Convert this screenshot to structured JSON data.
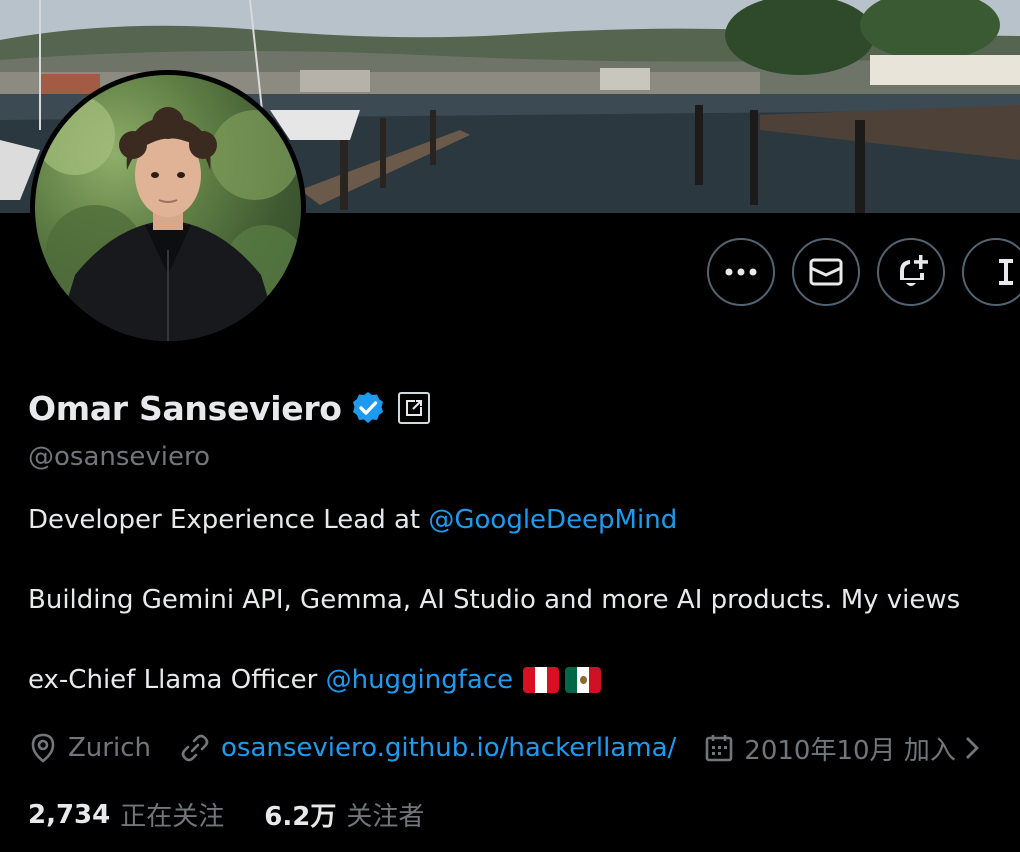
{
  "profile": {
    "display_name": "Omar Sanseviero",
    "handle": "@osanseviero",
    "verified": true,
    "bio": {
      "line1_text": "Developer Experience Lead at ",
      "line1_mention": "@GoogleDeepMind",
      "line2_text": "Building Gemini API, Gemma, AI Studio and more AI products. My views",
      "line3_text": "ex-Chief Llama Officer ",
      "line3_mention": "@huggingface",
      "flags": [
        "peru-flag",
        "mexico-flag"
      ]
    },
    "location": "Zurich",
    "website": "osanseviero.github.io/hackerllama/",
    "joined": "2010年10月 加入"
  },
  "stats": {
    "following_count": "2,734",
    "following_label": "正在关注",
    "followers_count": "6.2万",
    "followers_label": "关注者"
  },
  "actions": [
    {
      "name": "more-options-button",
      "icon": "ellipsis-icon"
    },
    {
      "name": "message-button",
      "icon": "envelope-icon"
    },
    {
      "name": "notifications-button",
      "icon": "bell-plus-icon"
    },
    {
      "name": "grok-button",
      "icon": "grok-icon"
    }
  ],
  "colors": {
    "background": "#000000",
    "text_primary": "#e7e9ea",
    "text_secondary": "#71767b",
    "accent": "#1d9bf0",
    "button_border": "#536471"
  }
}
